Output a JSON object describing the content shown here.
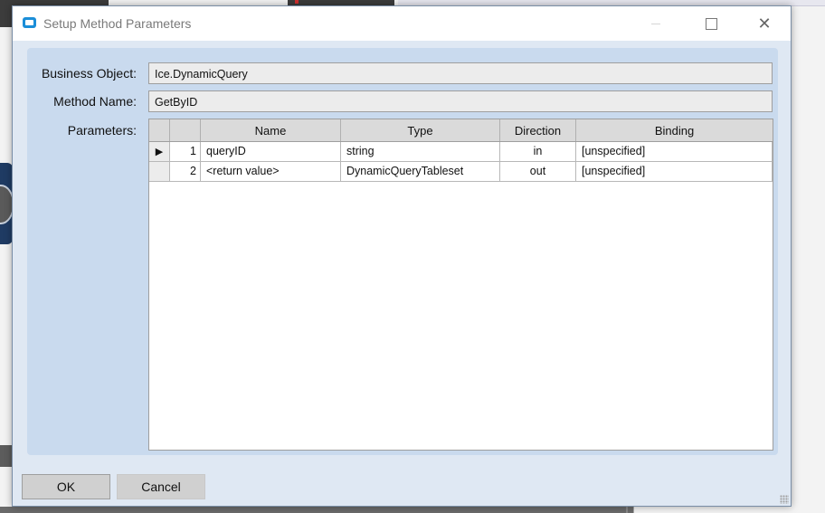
{
  "window": {
    "title": "Setup Method Parameters",
    "close_glyph": "✕"
  },
  "form": {
    "business_object_label": "Business Object:",
    "business_object_value": "Ice.DynamicQuery",
    "method_name_label": "Method Name:",
    "method_name_value": "GetByID",
    "parameters_label": "Parameters:"
  },
  "grid": {
    "columns": [
      "Name",
      "Type",
      "Direction",
      "Binding"
    ],
    "rows": [
      {
        "indicator": "▶",
        "num": "1",
        "name": "queryID",
        "type": "string",
        "direction": "in",
        "binding": "[unspecified]"
      },
      {
        "indicator": "",
        "num": "2",
        "name": "<return value>",
        "type": "DynamicQueryTableset",
        "direction": "out",
        "binding": "[unspecified]"
      }
    ]
  },
  "buttons": {
    "ok": "OK",
    "cancel": "Cancel"
  },
  "colors": {
    "dialog_bg": "#dfe8f3",
    "panel_bg": "#c9daee",
    "accent_icon": "#1b8ed8"
  }
}
